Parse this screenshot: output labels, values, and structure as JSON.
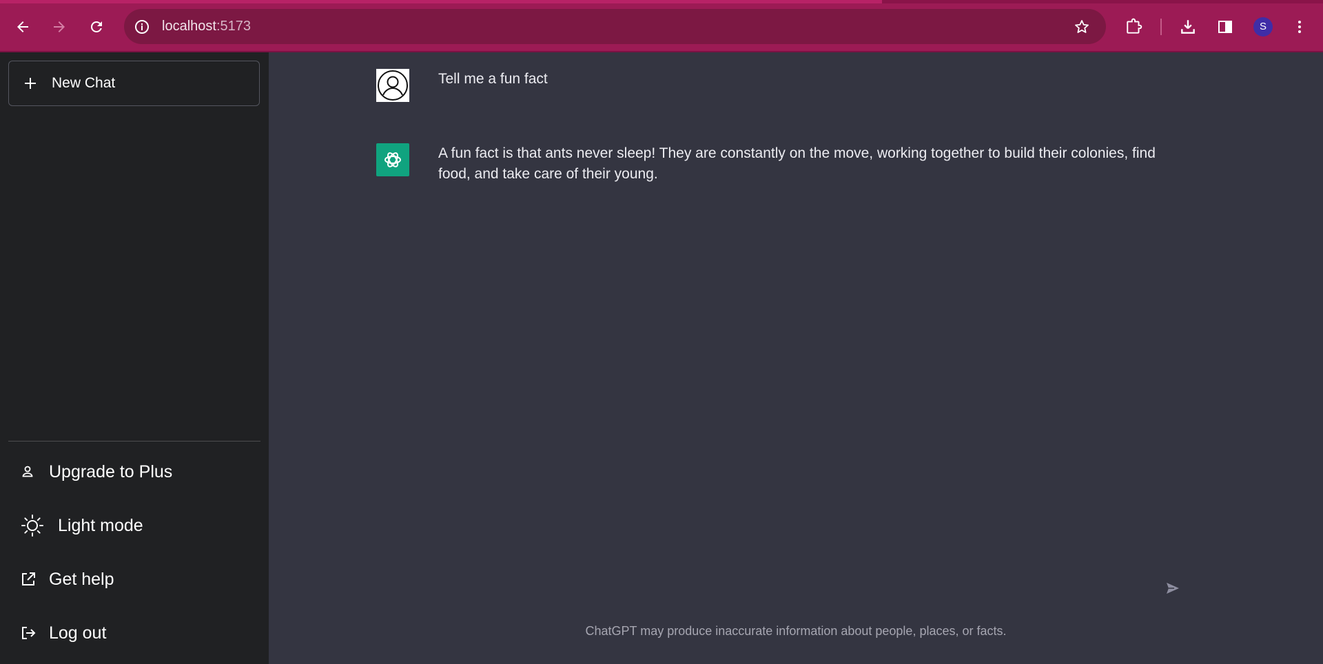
{
  "browser": {
    "url_host": "localhost",
    "url_port": ":5173",
    "profile_initial": "S",
    "theme_color": "#9c1b55"
  },
  "sidebar": {
    "new_chat_label": "New Chat",
    "items": [
      {
        "label": "Upgrade to Plus",
        "icon": "user-icon"
      },
      {
        "label": "Light mode",
        "icon": "sun-icon"
      },
      {
        "label": "Get help",
        "icon": "external-link-icon"
      },
      {
        "label": "Log out",
        "icon": "logout-icon"
      }
    ]
  },
  "chat": {
    "messages": [
      {
        "role": "user",
        "text": "Tell me a fun fact",
        "avatar_icon": "user-avatar-icon"
      },
      {
        "role": "assistant",
        "text": "A fun fact is that ants never sleep! They are constantly on the move, working together to build their colonies, find food, and take care of their young.",
        "avatar_icon": "openai-logo-icon"
      }
    ],
    "send_icon": "send-icon",
    "disclaimer": "ChatGPT may produce inaccurate information about people, places, or facts.",
    "accent_color": "#10a37f"
  }
}
